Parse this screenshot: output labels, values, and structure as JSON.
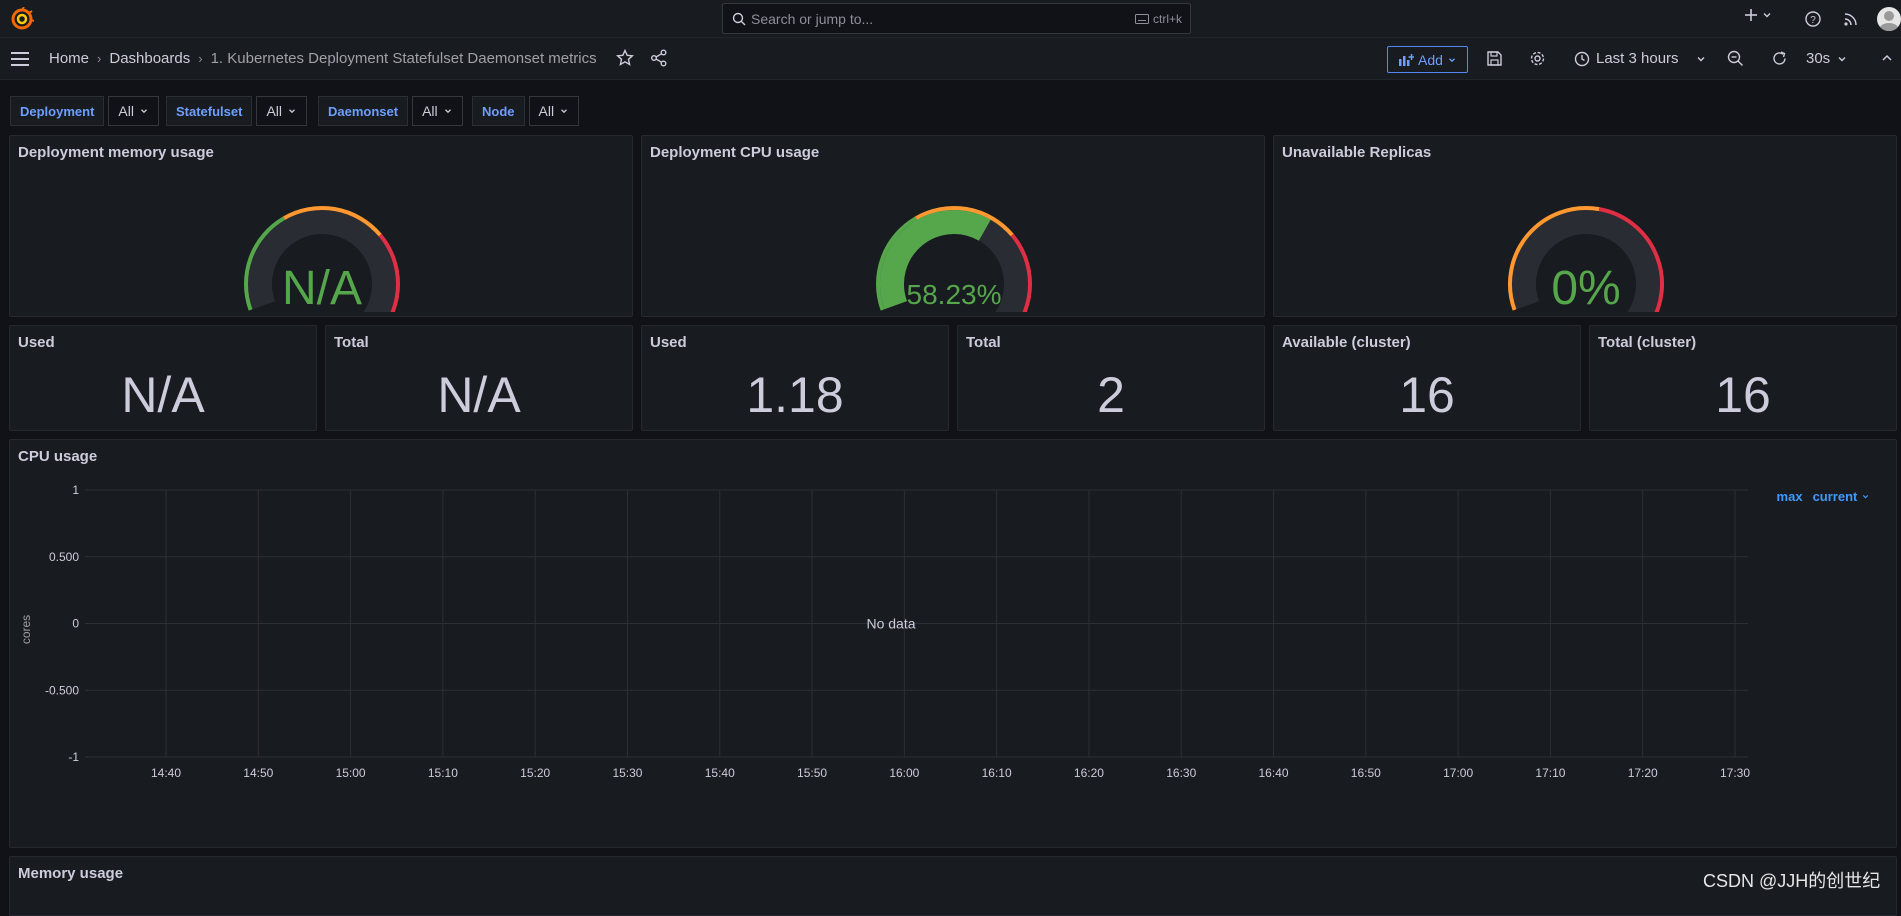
{
  "topbar": {
    "search_placeholder": "Search or jump to...",
    "search_shortcut": "ctrl+k"
  },
  "breadcrumb": {
    "home": "Home",
    "dashboards": "Dashboards",
    "current": "1. Kubernetes Deployment Statefulset Daemonset metrics"
  },
  "toolbar": {
    "add_label": "Add",
    "time_range": "Last 3 hours",
    "refresh_interval": "30s"
  },
  "variables": [
    {
      "label": "Deployment",
      "value": "All"
    },
    {
      "label": "Statefulset",
      "value": "All"
    },
    {
      "label": "Daemonset",
      "value": "All"
    },
    {
      "label": "Node",
      "value": "All"
    }
  ],
  "gauges": [
    {
      "title": "Deployment memory usage",
      "value": "N/A",
      "fraction": 0,
      "value_color": "#56a64b",
      "thresholds": [
        "#56a64b",
        "#ff9830",
        "#e02f44"
      ]
    },
    {
      "title": "Deployment CPU usage",
      "value": "58.23%",
      "fraction": 0.5823,
      "value_color": "#56a64b",
      "thresholds": [
        "#56a64b",
        "#ff9830",
        "#e02f44"
      ]
    },
    {
      "title": "Unavailable Replicas",
      "value": "0%",
      "fraction": 0,
      "value_color": "#56a64b",
      "thresholds": [
        "#ff9830",
        "#e02f44"
      ]
    }
  ],
  "stats": [
    {
      "title": "Used",
      "value": "N/A"
    },
    {
      "title": "Total",
      "value": "N/A"
    },
    {
      "title": "Used",
      "value": "1.18"
    },
    {
      "title": "Total",
      "value": "2"
    },
    {
      "title": "Available (cluster)",
      "value": "16"
    },
    {
      "title": "Total (cluster)",
      "value": "16"
    }
  ],
  "cpu_panel": {
    "title": "CPU usage",
    "no_data": "No data",
    "legend_max": "max",
    "legend_current": "current"
  },
  "memory_panel": {
    "title": "Memory usage"
  },
  "chart_data": {
    "type": "line",
    "title": "CPU usage",
    "ylabel": "cores",
    "xlabel": "",
    "ylim": [
      -1,
      1
    ],
    "y_ticks": [
      "1",
      "0.500",
      "0",
      "-0.500",
      "-1"
    ],
    "x_ticks": [
      "14:40",
      "14:50",
      "15:00",
      "15:10",
      "15:20",
      "15:30",
      "15:40",
      "15:50",
      "16:00",
      "16:10",
      "16:20",
      "16:30",
      "16:40",
      "16:50",
      "17:00",
      "17:10",
      "17:20",
      "17:30"
    ],
    "series": [],
    "grid": true
  },
  "watermark": "CSDN @JJH的创世纪",
  "colors": {
    "accent": "#6e9fff",
    "green": "#56a64b",
    "orange": "#ff9830",
    "red": "#e02f44"
  }
}
